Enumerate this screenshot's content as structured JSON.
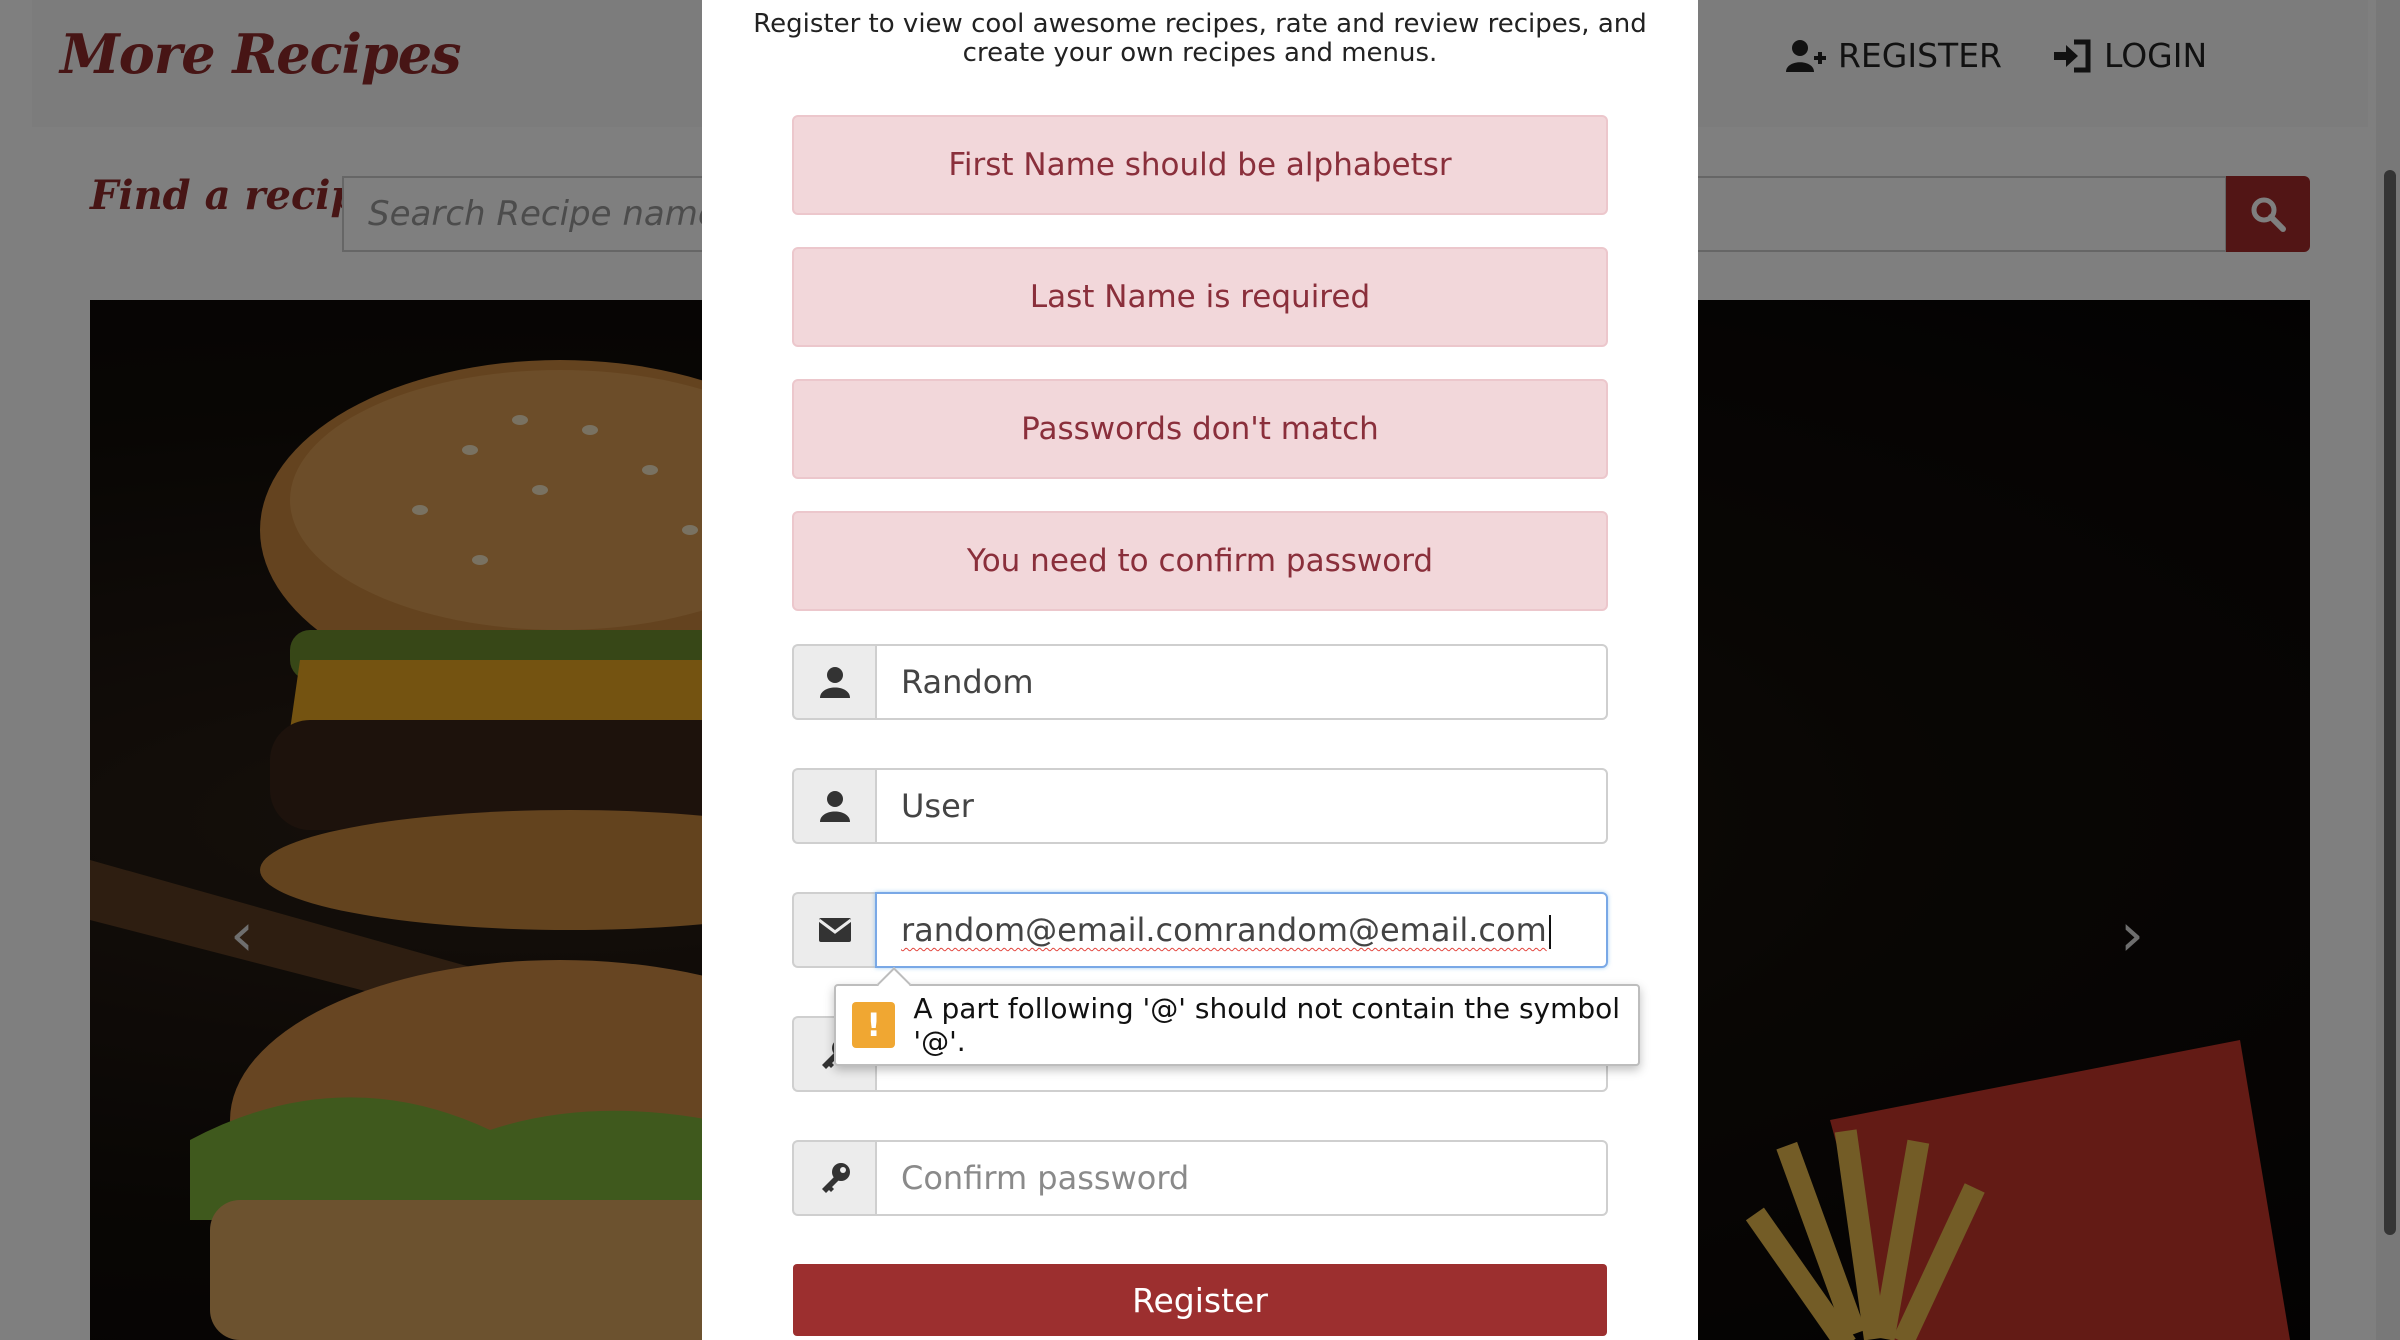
{
  "navbar": {
    "brand": "More Recipes",
    "register_label": "REGISTER",
    "login_label": "LOGIN"
  },
  "search": {
    "label": "Find a recipe:",
    "placeholder": "Search Recipe name or"
  },
  "carousel": {
    "prev_symbol": "‹",
    "next_symbol": "›"
  },
  "modal": {
    "intro": "Register to view cool awesome recipes, rate and review recipes, and create your own recipes and menus.",
    "alerts": [
      "First Name should be alphabetsr",
      "Last Name is required",
      "Passwords don't match",
      "You need to confirm password"
    ],
    "first_name_value": "Random",
    "last_name_value": "User",
    "email_value": "random@email.comrandom@email.com",
    "password_mask": "••••••••••••••••",
    "confirm_placeholder": "Confirm password",
    "validation_message": "A part following '@' should not contain the symbol '@'.",
    "warning_symbol": "!",
    "register_button": "Register"
  },
  "colors": {
    "brand": "#8f2a2a",
    "button": "#9c2f2f",
    "alert_bg": "#f2d7da",
    "alert_text": "#8a2f3b",
    "warning": "#f0a732"
  }
}
